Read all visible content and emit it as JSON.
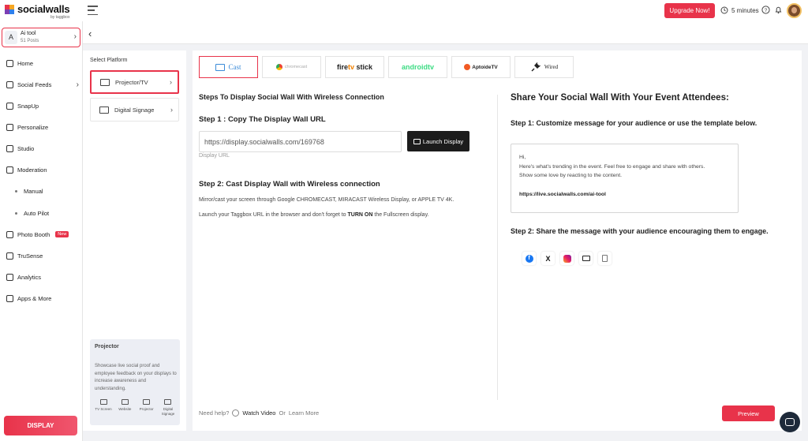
{
  "brand": {
    "name": "socialwalls",
    "sub": "by taggbox",
    "accent": "#e8334a"
  },
  "topbar": {
    "upgrade_label": "Upgrade Now!",
    "timer_label": "5 minutes",
    "icons": [
      "menu-icon",
      "clock-icon",
      "help-icon",
      "bell-icon"
    ]
  },
  "wall": {
    "letter": "A",
    "name": "Ai tool",
    "posts": "51 Posts"
  },
  "sidebar": {
    "items": [
      {
        "label": "Home",
        "icon": "home-icon"
      },
      {
        "label": "Social Feeds",
        "icon": "feeds-icon"
      },
      {
        "label": "SnapUp",
        "icon": "snapup-icon"
      },
      {
        "label": "Personalize",
        "icon": "personalize-icon"
      },
      {
        "label": "Studio",
        "icon": "studio-icon"
      },
      {
        "label": "Moderation",
        "icon": "moderation-icon"
      },
      {
        "label": "Manual"
      },
      {
        "label": "Auto Pilot"
      },
      {
        "label": "Photo Booth",
        "icon": "photo-booth-icon",
        "badge": "New"
      },
      {
        "label": "TruSense",
        "icon": "trusense-icon"
      },
      {
        "label": "Analytics",
        "icon": "analytics-icon"
      },
      {
        "label": "Apps & More",
        "icon": "apps-icon"
      }
    ],
    "display_label": "DISPLAY"
  },
  "platform": {
    "title": "Select Platform",
    "items": [
      {
        "label": "Projector/TV",
        "icon": "projector-icon"
      },
      {
        "label": "Digital Signage",
        "icon": "monitor-icon"
      }
    ],
    "info": {
      "title": "Projector",
      "desc": "Showcase live social proof and employee feedback on your displays to increase awareness and understanding.",
      "icons": [
        "TV Screen",
        "Website",
        "Projector",
        "Digital Signage"
      ]
    }
  },
  "tabs": {
    "cast": "Cast",
    "chromecast": "chromecast",
    "fire_a": "fire",
    "fire_b": "tv",
    "fire_c": "stick",
    "android": "androidtv",
    "aptoide": "AptoideTV",
    "wired": "Wired"
  },
  "main": {
    "heading": "Steps To Display Social Wall With Wireless Connection",
    "step1": "Step 1 : Copy The Display Wall URL",
    "url_value": "https://display.socialwalls.com/169768",
    "url_label": "Display URL",
    "launch_label": "Launch Display",
    "step2": "Step 2: Cast Display Wall with Wireless connection",
    "para1": "Mirror/cast your screen through Google CHROMECAST, MIRACAST Wireless Display, or APPLE TV 4K.",
    "para2_a": "Launch your Taggbox URL in the browser and don't forget to",
    "para2_b": "TURN ON",
    "para2_c": "the Fullscreen display."
  },
  "share": {
    "title": "Share Your Social Wall With Your Event Attendees:",
    "step1": "Step 1: Customize message for your audience or use the template below.",
    "msg_hi": "Hi,",
    "msg_l1": "Here's what's trending in the event. Feel free to engage and share with others.",
    "msg_l2": "Show some love by reacting to the content.",
    "msg_link": "https://live.socialwalls.com/ai-tool",
    "step2": "Step 2: Share the message with your audience encouraging them to engage.",
    "x_glyph": "X"
  },
  "footer": {
    "need_help": "Need help?",
    "watch_video": "Watch Video",
    "or": "Or",
    "learn_more": "Learn More",
    "preview_label": "Preview"
  }
}
